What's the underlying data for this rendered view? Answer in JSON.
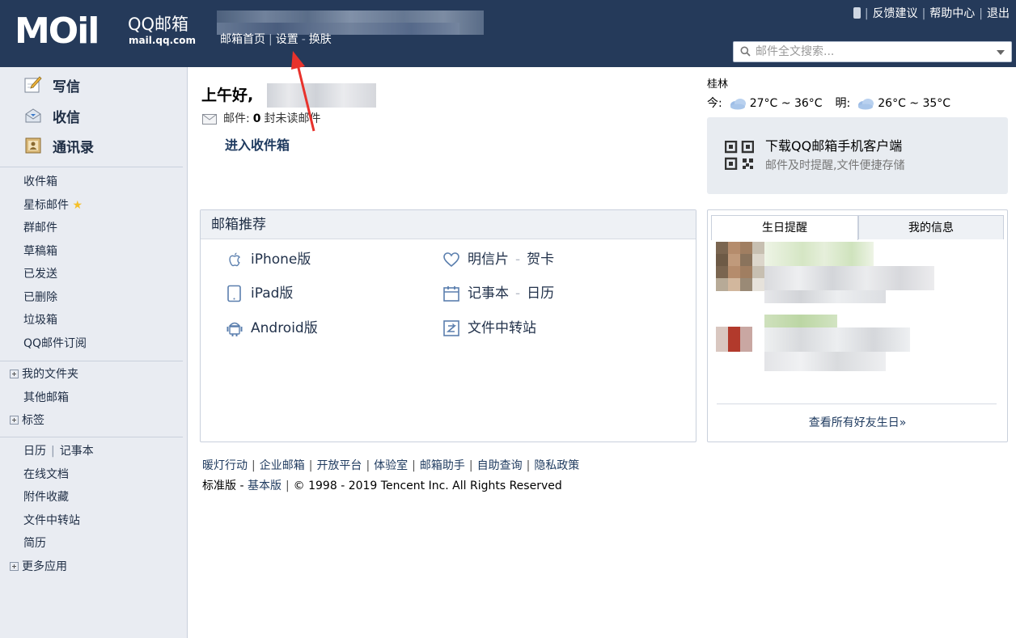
{
  "header": {
    "logo_mail": "MOil",
    "logo_brand": "QQ邮箱",
    "logo_url": "mail.qq.com",
    "nav": [
      "邮箱首页",
      "设置",
      "换肤"
    ],
    "links": [
      "反馈建议",
      "帮助中心",
      "退出"
    ],
    "search_placeholder": "邮件全文搜索..."
  },
  "sidebar": {
    "primary": [
      "写信",
      "收信",
      "通讯录"
    ],
    "folders": [
      "收件箱",
      "星标邮件",
      "群邮件",
      "草稿箱",
      "已发送",
      "已删除",
      "垃圾箱",
      "QQ邮件订阅"
    ],
    "groups": [
      "我的文件夹",
      "其他邮箱",
      "标签"
    ],
    "apps": {
      "calendar": "日历",
      "notes": "记事本",
      "docs": "在线文档",
      "attachments": "附件收藏",
      "transfer": "文件中转站",
      "resume": "简历",
      "more": "更多应用"
    }
  },
  "main": {
    "greeting": "上午好,",
    "mail_prefix": "邮件:",
    "unread_count": "0",
    "mail_suffix": "封未读邮件",
    "inbox_link": "进入收件箱",
    "weather": {
      "city": "桂林",
      "today_label": "今:",
      "today_temp": "27°C ~ 36°C",
      "tomorrow_label": "明:",
      "tomorrow_temp": "26°C ~ 35°C"
    },
    "promo": {
      "title": "下载QQ邮箱手机客户端",
      "subtitle": "邮件及时提醒,文件便捷存储"
    },
    "recommend": {
      "title": "邮箱推荐",
      "left": [
        "iPhone版",
        "iPad版",
        "Android版"
      ],
      "right": [
        {
          "a": "明信片",
          "b": "贺卡"
        },
        {
          "a": "记事本",
          "b": "日历"
        },
        {
          "a": "文件中转站",
          "b": ""
        }
      ]
    },
    "birthday": {
      "tabs": [
        "生日提醒",
        "我的信息"
      ],
      "link": "查看所有好友生日»"
    },
    "footer": {
      "links": [
        "暖灯行动",
        "企业邮箱",
        "开放平台",
        "体验室",
        "邮箱助手",
        "自助查询",
        "隐私政策"
      ],
      "version_std": "标准版",
      "version_basic": "基本版",
      "copyright": "© 1998 - 2019 Tencent Inc. All Rights Reserved"
    }
  },
  "colors": {
    "header_bg": "#253a5a",
    "sidebar_bg": "#e9ecf2",
    "link": "#1e3a5f",
    "annotation_arrow": "#e8322c"
  }
}
